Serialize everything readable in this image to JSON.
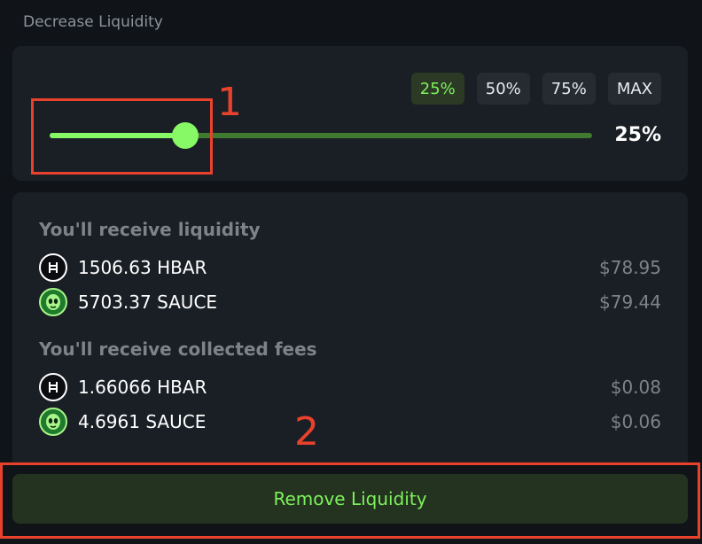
{
  "section": {
    "title": "Decrease Liquidity"
  },
  "slider": {
    "presets": [
      "25%",
      "50%",
      "75%",
      "MAX"
    ],
    "active_preset": "25%",
    "fraction": 0.25,
    "value_label": "25%"
  },
  "receive_liquidity": {
    "heading": "You'll receive liquidity",
    "rows": [
      {
        "icon": "hbar-icon",
        "amount": "1506.63 HBAR",
        "usd": "$78.95"
      },
      {
        "icon": "sauce-icon",
        "amount": "5703.37 SAUCE",
        "usd": "$79.44"
      }
    ]
  },
  "receive_fees": {
    "heading": "You'll receive collected fees",
    "rows": [
      {
        "icon": "hbar-icon",
        "amount": "1.66066 HBAR",
        "usd": "$0.08"
      },
      {
        "icon": "sauce-icon",
        "amount": "4.6961 SAUCE",
        "usd": "$0.06"
      }
    ]
  },
  "action": {
    "remove_label": "Remove Liquidity"
  },
  "annotations": {
    "marker1": "1",
    "marker2": "2"
  },
  "colors": {
    "accent": "#87f866",
    "track": "#3f7a30",
    "annotation": "#e8412c",
    "button_bg": "#24331f"
  }
}
